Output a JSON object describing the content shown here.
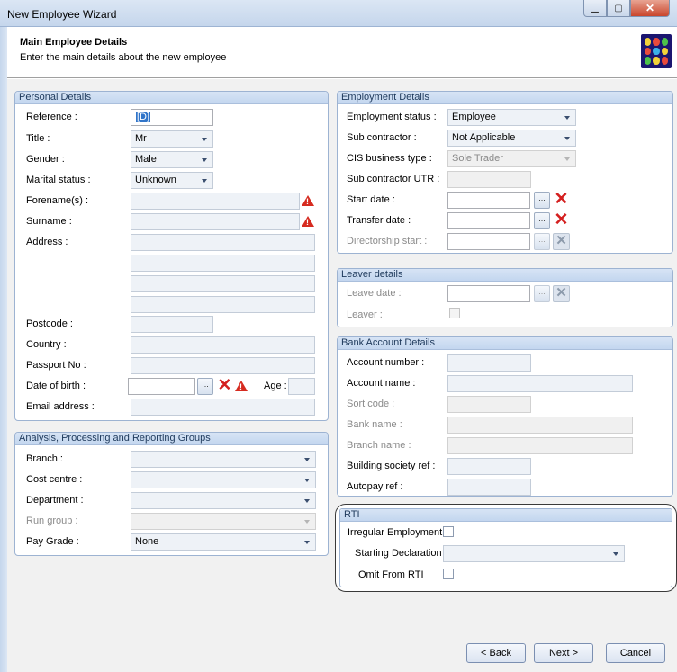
{
  "window": {
    "title": "New Employee Wizard"
  },
  "header": {
    "title": "Main Employee Details",
    "subtitle": "Enter the main details about the new employee",
    "icon": "people-group-icon"
  },
  "personal": {
    "title": "Personal Details",
    "reference_label": "Reference :",
    "reference_value": "[D]",
    "title_label": "Title :",
    "title_value": "Mr",
    "gender_label": "Gender :",
    "gender_value": "Male",
    "marital_label": "Marital status :",
    "marital_value": "Unknown",
    "forename_label": "Forename(s) :",
    "surname_label": "Surname :",
    "address_label": "Address :",
    "postcode_label": "Postcode :",
    "country_label": "Country :",
    "passport_label": "Passport No :",
    "dob_label": "Date of birth :",
    "dob_button": "...",
    "age_label": "Age :",
    "email_label": "Email address :"
  },
  "employment": {
    "title": "Employment Details",
    "status_label": "Employment status :",
    "status_value": "Employee",
    "subcontractor_label": "Sub contractor :",
    "subcontractor_value": "Not Applicable",
    "cis_label": "CIS business type :",
    "cis_value": "Sole Trader",
    "utr_label": "Sub contractor UTR :",
    "start_label": "Start date :",
    "transfer_label": "Transfer date :",
    "directorship_label": "Directorship start :",
    "date_button": "..."
  },
  "leaver": {
    "title": "Leaver details",
    "leave_date_label": "Leave date :",
    "leaver_label": "Leaver :",
    "date_button": "..."
  },
  "bank": {
    "title": "Bank Account Details",
    "account_number_label": "Account number :",
    "account_name_label": "Account name :",
    "sort_code_label": "Sort code :",
    "bank_name_label": "Bank name :",
    "branch_name_label": "Branch name :",
    "building_society_label": "Building society ref :",
    "autopay_label": "Autopay ref :"
  },
  "analysis": {
    "title": "Analysis, Processing and Reporting Groups",
    "branch_label": "Branch :",
    "cost_centre_label": "Cost centre :",
    "department_label": "Department :",
    "run_group_label": "Run group :",
    "pay_grade_label": "Pay Grade :",
    "pay_grade_value": "None"
  },
  "rti": {
    "title": "RTI",
    "irregular_label": "Irregular Employment",
    "starting_declaration_label": "Starting Declaration :",
    "omit_label": "Omit From RTI"
  },
  "footer": {
    "back_label": "< Back",
    "next_label": "Next >",
    "cancel_label": "Cancel"
  }
}
